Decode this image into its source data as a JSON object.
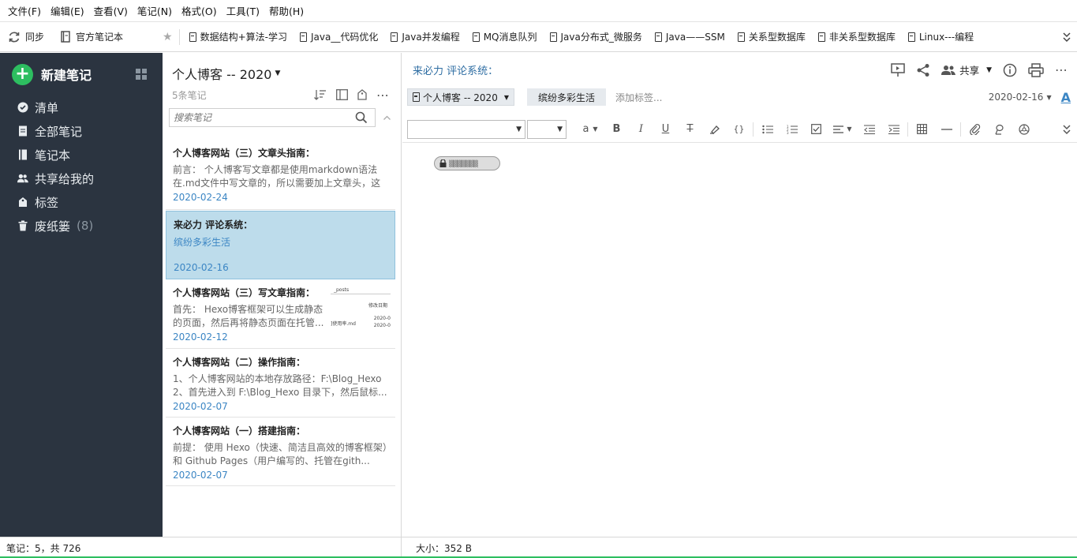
{
  "menubar": [
    "文件(F)",
    "编辑(E)",
    "查看(V)",
    "笔记(N)",
    "格式(O)",
    "工具(T)",
    "帮助(H)"
  ],
  "toolbar": {
    "sync": "同步",
    "official_notebook": "官方笔记本",
    "shortcuts": [
      "数据结构+算法-学习",
      "Java__代码优化",
      "Java并发编程",
      "MQ消息队列",
      "Java分布式_微服务",
      "Java——SSM",
      "关系型数据库",
      "非关系型数据库",
      "Linux---编程"
    ]
  },
  "sidebar": {
    "new_note": "新建笔记",
    "items": [
      {
        "label": "清单",
        "icon": "check-circle-icon"
      },
      {
        "label": "全部笔记",
        "icon": "notes-icon"
      },
      {
        "label": "笔记本",
        "icon": "notebook-icon"
      },
      {
        "label": "共享给我的",
        "icon": "people-icon"
      },
      {
        "label": "标签",
        "icon": "tag-icon"
      },
      {
        "label": "废纸篓",
        "icon": "trash-icon",
        "count": "(8)"
      }
    ]
  },
  "notelist": {
    "title": "个人博客 -- 2020",
    "count": "5条笔记",
    "search_placeholder": "搜索笔记",
    "notes": [
      {
        "title": "个人博客网站（三）文章头指南：",
        "snippet": "前言： 个人博客写文章都是使用markdown语法在.md文件中写文章的，所以需要加上文章头，这文...",
        "date": "2020-02-24"
      },
      {
        "title": "来必力 评论系统：",
        "tag": "缤纷多彩生活",
        "date": "2020-02-16"
      },
      {
        "title": "个人博客网站（三）写文章指南：",
        "snippet": "首先： Hexo博客框架可以生成静态的页面，然后再将静态页面在托管...",
        "date": "2020-02-12",
        "thumb": {
          "folder": "_posts",
          "col": "修改日期",
          "file": "]使用率.md",
          "d1": "2020-0",
          "d2": "2020-0"
        }
      },
      {
        "title": "个人博客网站（二）操作指南：",
        "snippet": "1、个人博客网站的本地存放路径：F:\\Blog_Hexo 2、首先进入到 F:\\Blog_Hexo 目录下，然后鼠标...",
        "date": "2020-02-07"
      },
      {
        "title": "个人博客网站（一）搭建指南：",
        "snippet": "前提： 使用 Hexo（快速、简洁且高效的博客框架）和 Github Pages（用户编写的、托管在gith...",
        "date": "2020-02-07"
      }
    ]
  },
  "editor": {
    "title": "来必力 评论系统：",
    "share": "共享",
    "notebook": "个人博客 -- 2020",
    "tag": "缤纷多彩生活",
    "add_tag": "添加标签...",
    "date": "2020-02-16",
    "font_a": "A",
    "size_glyph": "a",
    "encrypted": "▒▒▒▒▒▒▒"
  },
  "status": {
    "left": "笔记：5，共 726",
    "right": "大小：352 B"
  },
  "colors": {
    "accent": "#2dbe60",
    "sidebar_bg": "#2b3440",
    "selected_note": "#bddceb",
    "link": "#3c86c4"
  }
}
